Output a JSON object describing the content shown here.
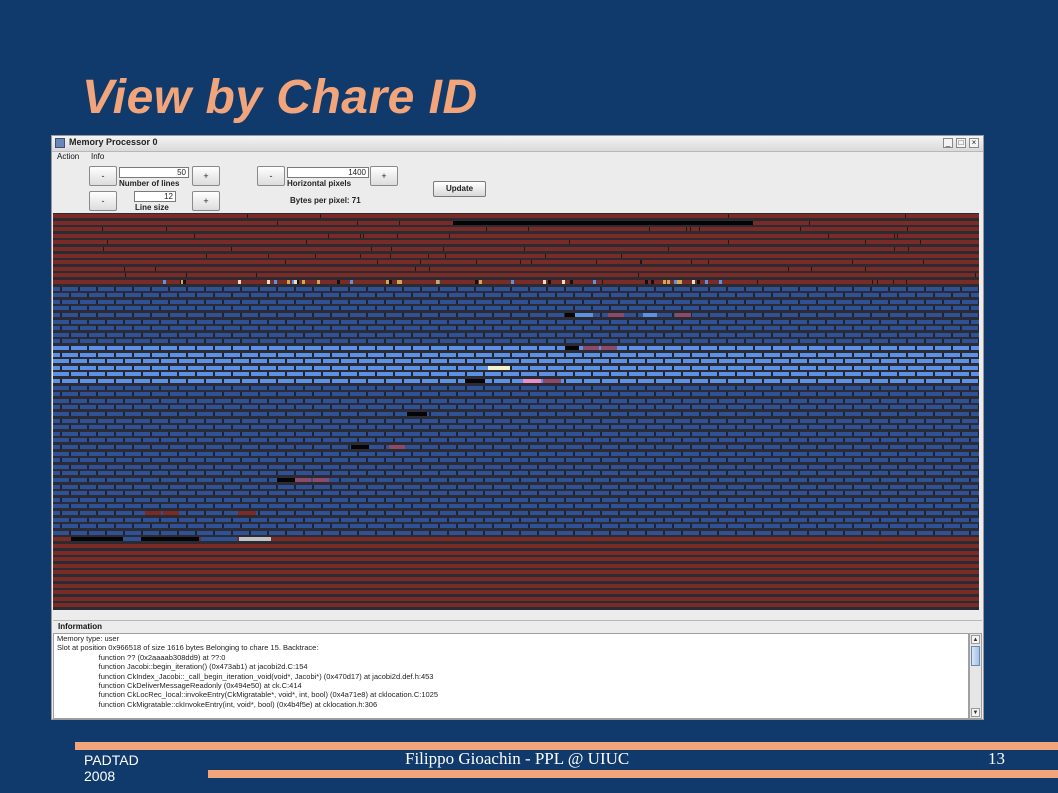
{
  "slide": {
    "title": "View by Chare ID"
  },
  "window": {
    "title": "Memory Processor 0",
    "controls": {
      "minimize": "_",
      "maximize": "□",
      "close": "×"
    }
  },
  "menu": {
    "action": "Action",
    "info": "Info"
  },
  "controls": {
    "minus": "-",
    "plus": "+",
    "number_of_lines": {
      "label": "Number of lines",
      "value": "50"
    },
    "line_size": {
      "label": "Line size",
      "value": "12"
    },
    "horizontal_pixels": {
      "label": "Horizontal pixels",
      "value": "1400"
    },
    "bytes_per_pixel": "Bytes per pixel: 71",
    "update_label": "Update"
  },
  "colors": {
    "allocated": "#7b2b25",
    "chare_other": "#2e5295",
    "chare_selected": "#5c92e6",
    "free": "#050505",
    "highlight_pink": "#e88fc7",
    "highlight_mauve": "#8c4a6a",
    "highlight_grey": "#c4c4c4",
    "highlight_pale": "#f3f3d0"
  },
  "information": {
    "label": "Information",
    "lines": [
      "Memory type: user",
      "Slot at position 0x966518 of size 1616 bytes Belonging to chare 15. Backtrace:",
      "                    function ?? (0x2aaaab308dd9) at ??:0",
      "                    function Jacobi::begin_iteration() (0x473ab1) at jacobi2d.C:154",
      "                    function CkIndex_Jacobi::_call_begin_iteration_void(void*, Jacobi*) (0x470d17) at jacobi2d.def.h:453",
      "                    function CkDeliverMessageReadonly (0x494e50) at ck.C:414",
      "                    function CkLocRec_local::invokeEntry(CkMigratable*, void*, int, bool) (0x4a71e8) at cklocation.C:1025",
      "                    function CkMigratable::ckInvokeEntry(int, void*, bool) (0x4b4f5e) at cklocation.h:306"
    ]
  },
  "footer": {
    "left": "PADTAD\n2008",
    "center": "Filippo Gioachin - PPL @ UIUC",
    "page_number": "13"
  }
}
